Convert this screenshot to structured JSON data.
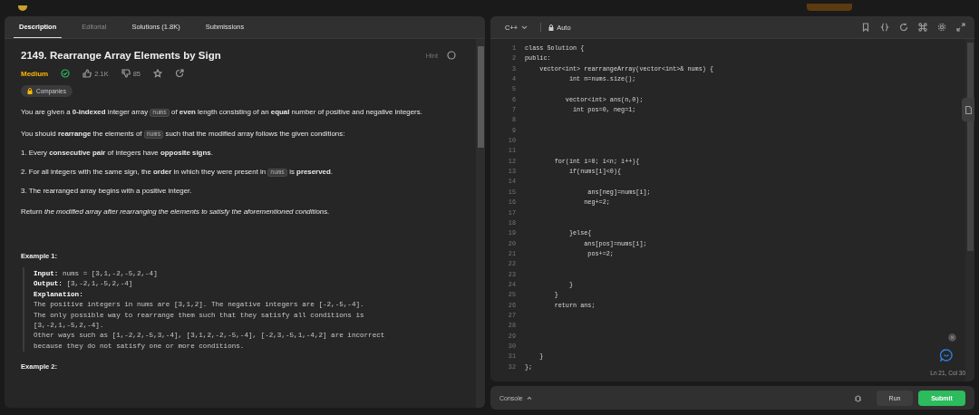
{
  "tabs": [
    {
      "label": "Description",
      "selected": true,
      "disabled": false
    },
    {
      "label": "Editorial",
      "selected": false,
      "disabled": true
    },
    {
      "label": "Solutions (1.8K)",
      "selected": false,
      "disabled": false
    },
    {
      "label": "Submissions",
      "selected": false,
      "disabled": false
    }
  ],
  "problem": {
    "title": "2149. Rearrange Array Elements by Sign",
    "hint": "Hint",
    "difficulty": "Medium",
    "solved": true,
    "likes": "2.1K",
    "dislikes": "85",
    "companies": "Companies"
  },
  "description": [
    {
      "kind": "para",
      "parts": [
        {
          "kind": "text",
          "text": "You are given a **0-indexed** integer array "
        },
        {
          "kind": "code",
          "text": "nums"
        },
        {
          "kind": "text",
          "text": " of **even** length consisting of an **equal** number of positive and negative integers."
        }
      ]
    },
    {
      "kind": "para",
      "parts": [
        {
          "kind": "text",
          "text": "You should **rearrange** the elements of "
        },
        {
          "kind": "code",
          "text": "nums"
        },
        {
          "kind": "text",
          "text": " such that the modified array follows the given conditions:"
        }
      ]
    },
    {
      "kind": "item",
      "parts": [
        {
          "kind": "text",
          "text": "1. Every **consecutive pair** of integers have **opposite signs**."
        }
      ]
    },
    {
      "kind": "item",
      "parts": [
        {
          "kind": "text",
          "text": "2. For all integers with the same sign, the **order** in which they were present in "
        },
        {
          "kind": "code",
          "text": "nums"
        },
        {
          "kind": "text",
          "text": " is **preserved**."
        }
      ]
    },
    {
      "kind": "item",
      "parts": [
        {
          "kind": "text",
          "text": "3. The rearranged array begins with a positive integer."
        }
      ]
    },
    {
      "kind": "para",
      "parts": [
        {
          "kind": "text",
          "text": "Return *the modified array after rearranging the elements to satisfy the aforementioned conditions.*"
        }
      ]
    }
  ],
  "examples": [
    {
      "title": "Example 1:",
      "lines": [
        {
          "label": "Input:",
          "text": "nums = [3,1,-2,-5,2,-4]"
        },
        {
          "label": "Output:",
          "text": "[3,-2,1,-5,2,-4]"
        },
        {
          "label": "Explanation:"
        },
        {
          "text": "The positive integers in nums are [3,1,2]. The negative integers are [-2,-5,-4]."
        },
        {
          "text": "The only possible way to rearrange them such that they satisfy all conditions is"
        },
        {
          "text": "[3,-2,1,-5,2,-4]."
        },
        {
          "text": "Other ways such as [1,-2,2,-5,3,-4], [3,1,2,-2,-5,-4], [-2,3,-5,1,-4,2] are incorrect"
        },
        {
          "text": "because they do not satisfy one or more conditions."
        }
      ]
    },
    {
      "title": "Example 2:"
    }
  ],
  "editor": {
    "language": "C++",
    "mode": "Auto",
    "lines": [
      {
        "n": "1",
        "code": "class Solution {"
      },
      {
        "n": "2",
        "code": "public:"
      },
      {
        "n": "3",
        "code": "    vector<int> rearrangeArray(vector<int>& nums) {"
      },
      {
        "n": "4",
        "code": "            int n=nums.size();"
      },
      {
        "n": "5"
      },
      {
        "n": "6",
        "code": "           vector<int> ans(n,0);"
      },
      {
        "n": "7",
        "code": "             int pos=0, neg=1;"
      },
      {
        "n": "8"
      },
      {
        "n": "9"
      },
      {
        "n": "10"
      },
      {
        "n": "11"
      },
      {
        "n": "12",
        "code": "        for(int i=0; i<n; i++){"
      },
      {
        "n": "13",
        "code": "            if(nums[i]<0){"
      },
      {
        "n": "14"
      },
      {
        "n": "15",
        "code": "                 ans[neg]=nums[i];"
      },
      {
        "n": "16",
        "code": "                neg+=2;"
      },
      {
        "n": "17"
      },
      {
        "n": "18"
      },
      {
        "n": "19",
        "code": "            }else{"
      },
      {
        "n": "20",
        "code": "                ans[pos]=nums[i];"
      },
      {
        "n": "21",
        "code": "                 pos+=2;"
      },
      {
        "n": "22"
      },
      {
        "n": "23"
      },
      {
        "n": "24",
        "code": "            }"
      },
      {
        "n": "25",
        "code": "        }"
      },
      {
        "n": "26",
        "code": "        return ans;"
      },
      {
        "n": "27"
      },
      {
        "n": "28"
      },
      {
        "n": "29"
      },
      {
        "n": "30"
      },
      {
        "n": "31",
        "code": "    }"
      },
      {
        "n": "32",
        "code": "};"
      }
    ],
    "cursor": "Ln 21, Col 30"
  },
  "console": {
    "label": "Console",
    "run": "Run",
    "submit": "Submit"
  }
}
